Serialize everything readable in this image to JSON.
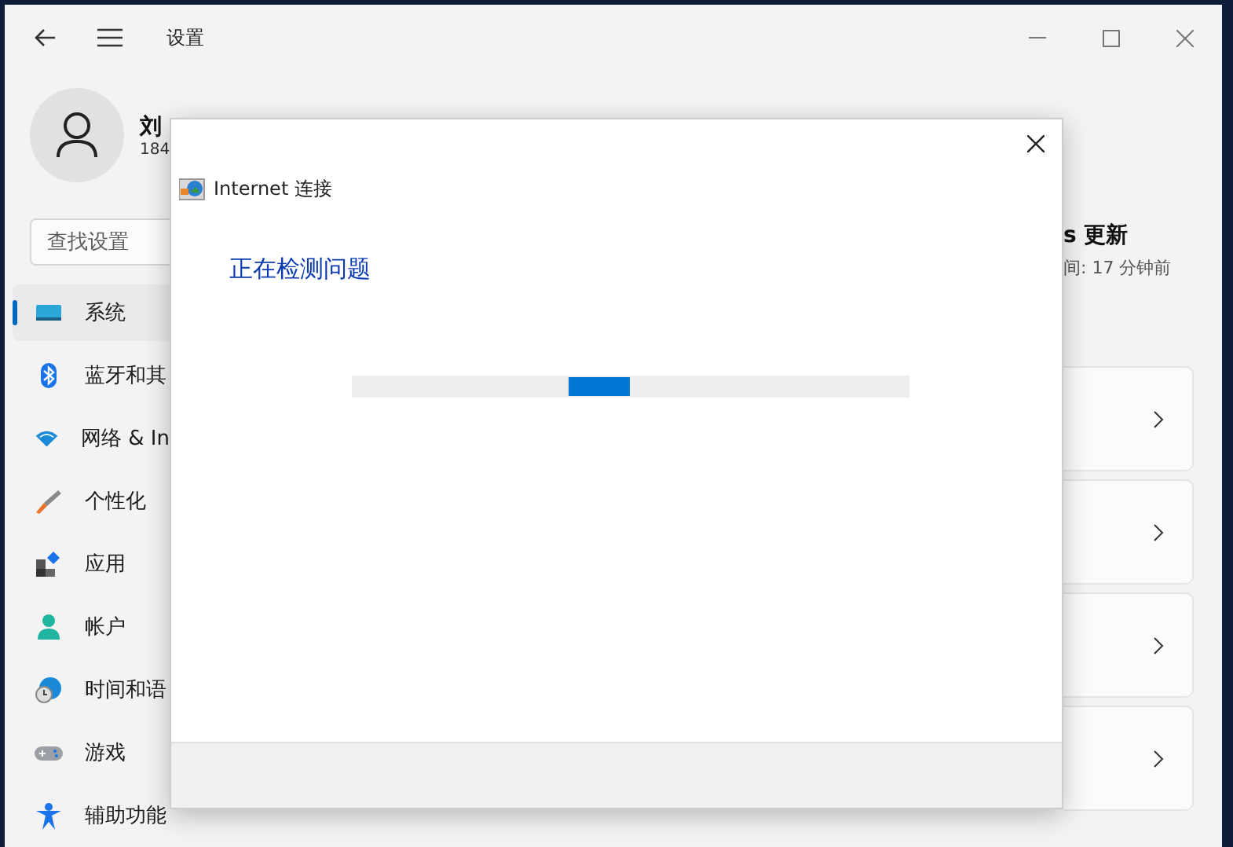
{
  "settings_window": {
    "title": "设置"
  },
  "profile": {
    "name": "刘",
    "detail": "184"
  },
  "search": {
    "placeholder": "查找设置"
  },
  "sidebar": {
    "items": [
      {
        "label": "系统",
        "selected": true
      },
      {
        "label": "蓝牙和其",
        "selected": false
      },
      {
        "label": "网络 & In",
        "selected": false
      },
      {
        "label": "个性化",
        "selected": false
      },
      {
        "label": "应用",
        "selected": false
      },
      {
        "label": "帐户",
        "selected": false
      },
      {
        "label": "时间和语",
        "selected": false
      },
      {
        "label": "游戏",
        "selected": false
      },
      {
        "label": "辅助功能",
        "selected": false
      }
    ]
  },
  "update_panel": {
    "title": "s 更新",
    "subtitle": "间: 17 分钟前"
  },
  "dialog": {
    "title": "Internet 连接",
    "heading": "正在检测问题",
    "progress": {
      "indeterminate": true
    }
  }
}
